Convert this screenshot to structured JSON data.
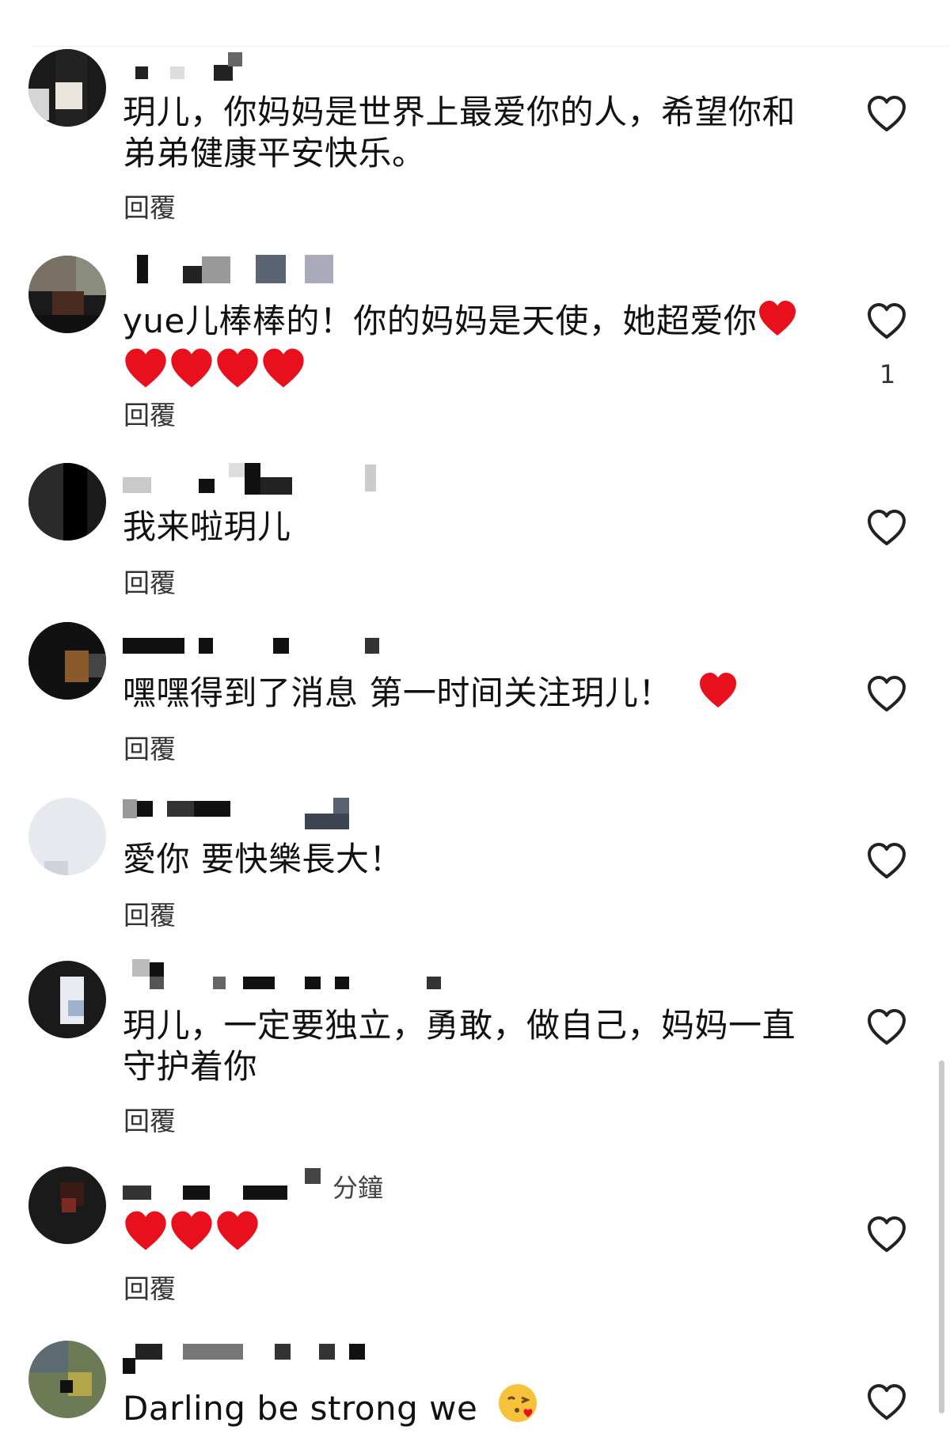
{
  "comments": [
    {
      "text": "玥儿，你妈妈是世界上最爱你的人，希望你和弟弟健康平安快乐。",
      "reply": "回覆",
      "likes": ""
    },
    {
      "text": "yue儿棒棒的！你的妈妈是天使，她超爱你",
      "emoji": "❤️❤️❤️❤️❤️",
      "reply": "回覆",
      "likes": "1"
    },
    {
      "text": "我来啦玥儿",
      "reply": "回覆",
      "likes": ""
    },
    {
      "text": "嘿嘿得到了消息 第一时间关注玥儿！",
      "emoji": "❤️",
      "reply": "回覆",
      "likes": ""
    },
    {
      "text": "愛你 要快樂長大！",
      "reply": "回覆",
      "likes": ""
    },
    {
      "text": "玥儿，一定要独立，勇敢，做自己，妈妈一直守护着你",
      "reply": "回覆",
      "likes": ""
    },
    {
      "text": "",
      "emoji": "❤️❤️❤️",
      "time": "分鐘",
      "reply": "回覆",
      "likes": ""
    },
    {
      "text": "Darling be strong we",
      "emoji": "😘",
      "likes": ""
    }
  ],
  "icons": {
    "like": "heart-outline-icon",
    "emoji_heart": "red-heart-emoji",
    "emoji_kiss": "kiss-face-emoji"
  },
  "colors": {
    "heart": "#e8101c",
    "text": "#111111",
    "reply": "#333333",
    "icon": "#222222"
  }
}
